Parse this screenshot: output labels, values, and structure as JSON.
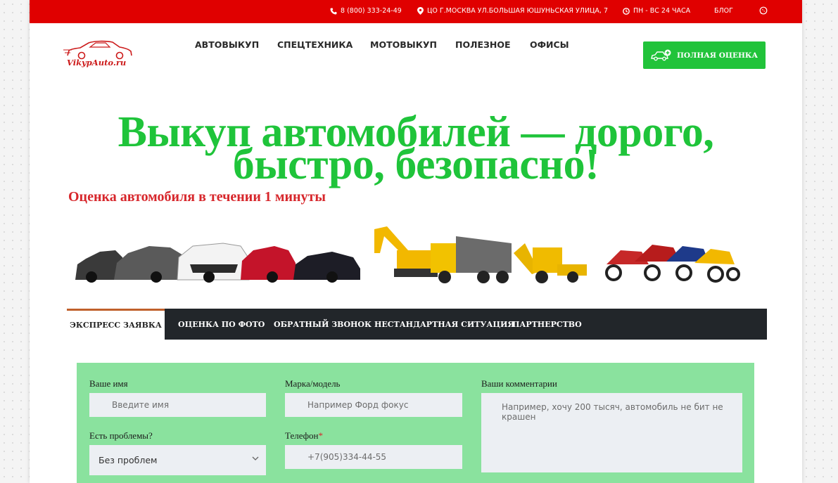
{
  "topbar": {
    "phone": "8 (800) 333-24-49",
    "address": "ЦО Г.МОСКВА УЛ.БОЛЬШАЯ ЮШУНЬСКАЯ УЛИЦА, 7",
    "hours": "ПН - ВС 24 ЧАСА",
    "blog": "БЛОГ"
  },
  "logo": {
    "text": "VikypAuto.ru"
  },
  "nav": {
    "items": [
      "АВТОВЫКУП",
      "СПЕЦТЕХНИКА",
      "МОТОВЫКУП",
      "ПОЛЕЗНОЕ",
      "ОФИСЫ"
    ]
  },
  "cta": {
    "label": "ПОЛНАЯ ОЦЕНКА"
  },
  "hero": {
    "title_line1": "Выкуп автомобилей — дорого,",
    "title_line2": "быстро, безопасно!",
    "subtitle": "Оценка автомобиля в течении 1 минуты"
  },
  "tabs": [
    "ЭКСПРЕСС ЗАЯВКА",
    "ОЦЕНКА ПО ФОТО",
    "ОБРАТНЫЙ ЗВОНОК",
    "НЕСТАНДАРТНАЯ СИТУАЦИЯ",
    "ПАРТНЕРСТВО"
  ],
  "form": {
    "name_label": "Ваше имя",
    "name_placeholder": "Введите имя",
    "model_label": "Марка/модель",
    "model_placeholder": "Например Форд фокус",
    "comment_label": "Ваши комментарии",
    "comment_placeholder": "Например, хочу 200 тысяч, автомобиль не бит не крашен",
    "problems_label": "Есть проблемы?",
    "problems_value": "Без проблем",
    "phone_label": "Телефон",
    "phone_required": "*",
    "phone_placeholder": "+7(905)334-44-55"
  },
  "colors": {
    "topbar": "#e00000",
    "accent_green": "#21c33a",
    "headline_green": "#1fc43a",
    "subtitle_red": "#d7262b",
    "tabs_bg": "#22262a",
    "active_tab_border": "#c0602c",
    "form_bg": "#8ae29e"
  }
}
